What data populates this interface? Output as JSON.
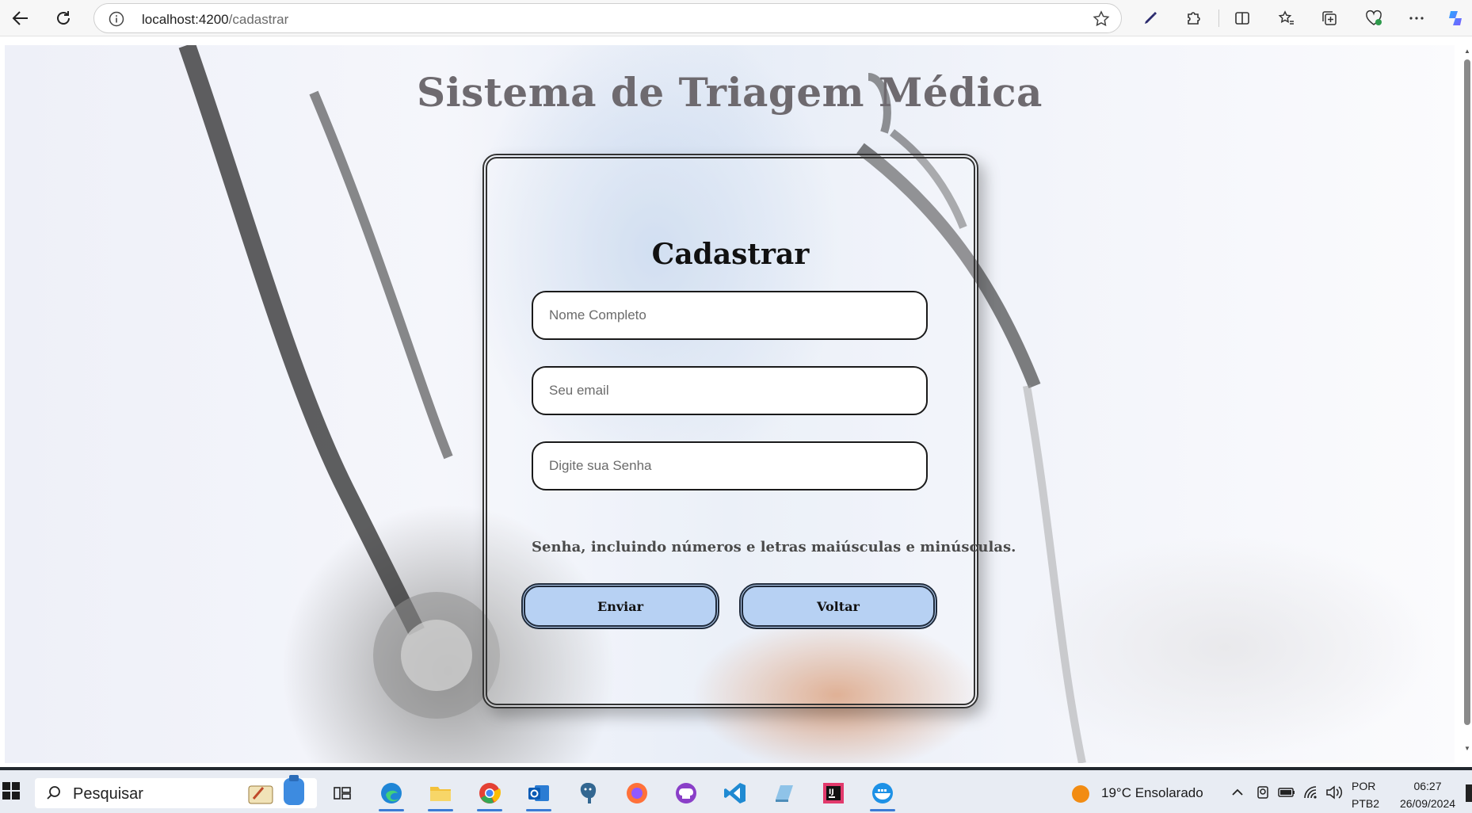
{
  "browser": {
    "url_host": "localhost:4200",
    "url_path": "/cadastrar"
  },
  "page": {
    "title": "Sistema de Triagem Médica",
    "form_title": "Cadastrar",
    "fields": {
      "name_placeholder": "Nome Completo",
      "email_placeholder": "Seu email",
      "password_placeholder": "Digite sua Senha"
    },
    "password_hint": "Senha, incluindo números e letras maiúsculas e minúsculas.",
    "buttons": {
      "submit": "Enviar",
      "back": "Voltar"
    },
    "colors": {
      "button_fill": "#b7d1f3",
      "title_color": "#6e6a6f"
    }
  },
  "taskbar": {
    "search_text": "Pesquisar",
    "weather": "19°C  Ensolarado",
    "language_top": "POR",
    "language_bottom": "PTB2",
    "time": "06:27",
    "date": "26/09/2024"
  }
}
